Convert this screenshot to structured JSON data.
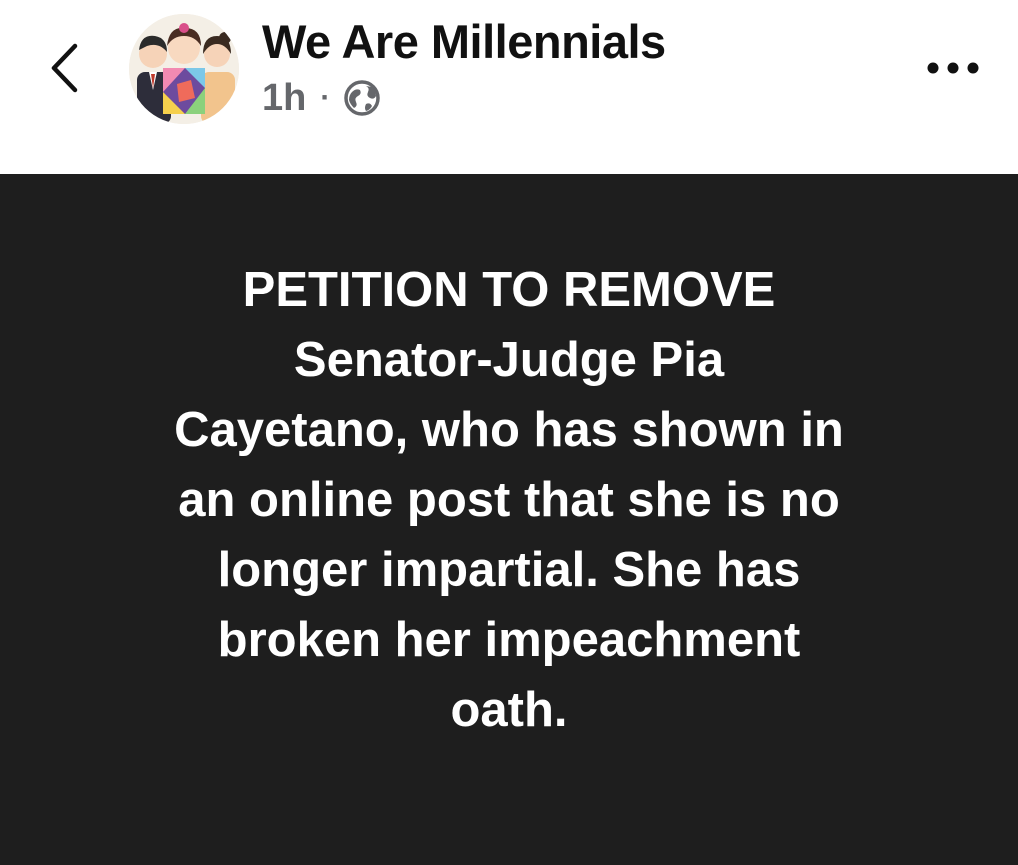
{
  "header": {
    "page_name": "We Are Millennials",
    "timestamp": "1h",
    "separator": "·",
    "audience_icon": "globe-icon",
    "back_icon": "chevron-left-icon",
    "more_icon": "more-horizontal-icon"
  },
  "post": {
    "background_color": "#1e1e1e",
    "text_color": "#ffffff",
    "lines": [
      "PETITION TO REMOVE",
      "Senator-Judge Pia",
      "Cayetano, who has shown in",
      "an online post that she is no",
      "longer impartial. She has",
      "broken her impeachment",
      "oath."
    ]
  }
}
